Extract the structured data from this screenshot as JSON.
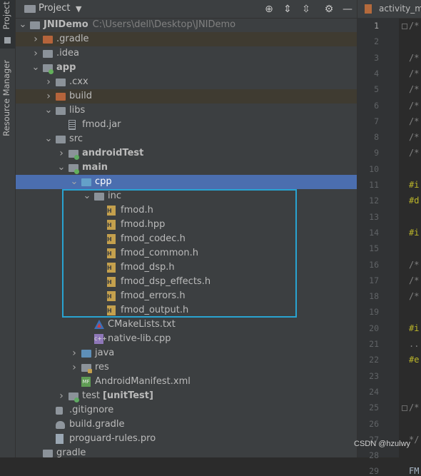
{
  "side_strip": {
    "project_tab": "Project",
    "resource_manager_tab": "Resource Manager"
  },
  "panel": {
    "title": "Project"
  },
  "tree": [
    {
      "label": "JNIDemo",
      "path": "C:\\Users\\dell\\Desktop\\JNIDemo",
      "icon": "folder-grey",
      "bold": true
    },
    {
      "label": ".gradle",
      "icon": "folder-orange",
      "excluded": true
    },
    {
      "label": ".idea",
      "icon": "folder-grey"
    },
    {
      "label": "app",
      "icon": "folder-module",
      "bold": true
    },
    {
      "label": ".cxx",
      "icon": "folder-grey"
    },
    {
      "label": "build",
      "icon": "folder-orange",
      "excluded": true
    },
    {
      "label": "libs",
      "icon": "folder-grey"
    },
    {
      "label": "fmod.jar",
      "icon": "jar-icon"
    },
    {
      "label": "src",
      "icon": "folder-grey"
    },
    {
      "label": "androidTest",
      "icon": "folder-test",
      "bold": true
    },
    {
      "label": "main",
      "icon": "folder-module",
      "bold": true
    },
    {
      "label": "cpp",
      "icon": "folder-blue",
      "selected": true
    },
    {
      "label": "inc",
      "icon": "folder-grey"
    },
    {
      "label": "fmod.h",
      "icon": "header-file-icon"
    },
    {
      "label": "fmod.hpp",
      "icon": "header-file-icon"
    },
    {
      "label": "fmod_codec.h",
      "icon": "header-file-icon"
    },
    {
      "label": "fmod_common.h",
      "icon": "header-file-icon"
    },
    {
      "label": "fmod_dsp.h",
      "icon": "header-file-icon"
    },
    {
      "label": "fmod_dsp_effects.h",
      "icon": "header-file-icon"
    },
    {
      "label": "fmod_errors.h",
      "icon": "header-file-icon"
    },
    {
      "label": "fmod_output.h",
      "icon": "header-file-icon"
    },
    {
      "label": "CMakeLists.txt",
      "icon": "cmake-icon"
    },
    {
      "label": "native-lib.cpp",
      "icon": "cpp-file-icon"
    },
    {
      "label": "java",
      "icon": "folder-cyan"
    },
    {
      "label": "res",
      "icon": "folder-res"
    },
    {
      "label": "AndroidManifest.xml",
      "icon": "manifest-icon"
    },
    {
      "label": "test",
      "suffix": "[unitTest]",
      "icon": "folder-test"
    },
    {
      "label": ".gitignore",
      "icon": "gitignore-icon"
    },
    {
      "label": "build.gradle",
      "icon": "gradle-icon"
    },
    {
      "label": "proguard-rules.pro",
      "icon": "text-file-icon"
    },
    {
      "label": "gradle",
      "icon": "folder-grey"
    }
  ],
  "editor": {
    "tab_label": "activity_ma",
    "line_numbers": [
      "1",
      "2",
      "3",
      "4",
      "5",
      "6",
      "7",
      "8",
      "9",
      "10",
      "11",
      "12",
      "13",
      "14",
      "15",
      "16",
      "17",
      "18",
      "19",
      "20",
      "21",
      "22",
      "23",
      "24",
      "25",
      "26",
      "27",
      "28",
      "29"
    ],
    "code_lines": [
      {
        "line": 1,
        "text": "/*"
      },
      {
        "line": 3,
        "text": "/*"
      },
      {
        "line": 4,
        "text": "/*"
      },
      {
        "line": 5,
        "text": "/*"
      },
      {
        "line": 6,
        "text": "/*"
      },
      {
        "line": 7,
        "text": "/*"
      },
      {
        "line": 8,
        "text": "/*"
      },
      {
        "line": 9,
        "text": "/*"
      },
      {
        "line": 11,
        "text": "#i"
      },
      {
        "line": 12,
        "text": "#d"
      },
      {
        "line": 14,
        "text": "#i"
      },
      {
        "line": 16,
        "text": "/*"
      },
      {
        "line": 17,
        "text": "/*"
      },
      {
        "line": 18,
        "text": "/*"
      },
      {
        "line": 20,
        "text": "#i"
      },
      {
        "line": 21,
        "text": ".."
      },
      {
        "line": 22,
        "text": "#e"
      },
      {
        "line": 25,
        "text": "/*"
      },
      {
        "line": 27,
        "text": "*/"
      },
      {
        "line": 29,
        "text": "FM"
      }
    ]
  },
  "watermark": "CSDN @hzulwy",
  "colors": {
    "selection": "#4b6eaf",
    "highlight_box": "#29a3d1",
    "panel_bg": "#3c3f41",
    "editor_bg": "#2b2b2b"
  }
}
